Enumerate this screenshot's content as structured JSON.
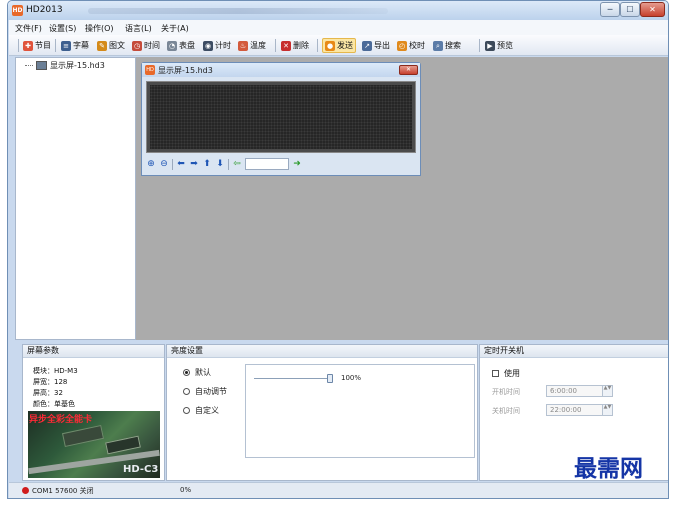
{
  "window": {
    "title": "HD2013",
    "app_icon_label": "HD",
    "minimize_glyph": "─",
    "maximize_glyph": "☐",
    "close_glyph": "✕"
  },
  "menu": [
    {
      "label": "文件(F)"
    },
    {
      "label": "设置(S)"
    },
    {
      "label": "操作(O)"
    },
    {
      "label": "语言(L)"
    },
    {
      "label": "关于(A)"
    }
  ],
  "toolbar": [
    {
      "label": "节目",
      "icon": "program-icon",
      "glyph": "✚",
      "color": "#e0533c"
    },
    {
      "label": "字幕",
      "icon": "subtitle-icon",
      "glyph": "≡",
      "color": "#3d5f8f"
    },
    {
      "label": "图文",
      "icon": "picture-text-icon",
      "glyph": "✎",
      "color": "#d48a1a"
    },
    {
      "label": "时间",
      "icon": "time-icon",
      "glyph": "◷",
      "color": "#c54b3a"
    },
    {
      "label": "表盘",
      "icon": "dial-icon",
      "glyph": "◔",
      "color": "#7a8797"
    },
    {
      "label": "计时",
      "icon": "timer-icon",
      "glyph": "◉",
      "color": "#3c4c63"
    },
    {
      "label": "温度",
      "icon": "temperature-icon",
      "glyph": "♨",
      "color": "#d35a3c"
    },
    {
      "label": "删除",
      "icon": "delete-icon",
      "glyph": "✕",
      "color": "#c72e2e"
    },
    {
      "label": "发送",
      "icon": "send-icon",
      "glyph": "●",
      "color": "#e88a16",
      "active": true
    },
    {
      "label": "导出",
      "icon": "export-icon",
      "glyph": "↗",
      "color": "#4b6a98"
    },
    {
      "label": "校时",
      "icon": "clock-sync-icon",
      "glyph": "◴",
      "color": "#e08a1d"
    },
    {
      "label": "搜索",
      "icon": "search-icon",
      "glyph": "⌕",
      "color": "#5b7ca8"
    },
    {
      "label": "预览",
      "icon": "preview-icon",
      "glyph": "▶",
      "color": "#3d4a5a"
    }
  ],
  "tree": {
    "item_label": "显示屏-15.hd3"
  },
  "child_window": {
    "title": "显示屏-15.hd3",
    "close_glyph": "✕",
    "tools": {
      "zoom_in": "⊕",
      "zoom_out": "⊖",
      "left": "⬅",
      "right": "➡",
      "up": "⬆",
      "down": "⬇",
      "go_back": "⇦",
      "go_forward": "➜",
      "position_value": ""
    }
  },
  "screen_params": {
    "header": "屏幕参数",
    "module": "模块：HD-M3",
    "width": "屏宽：128",
    "height": "屏高：32",
    "color": "颜色：单基色",
    "photo_headline": "异步全彩全能卡",
    "photo_badge": "HD-C3"
  },
  "brightness": {
    "header": "亮度设置",
    "options": [
      {
        "label": "默认",
        "selected": true
      },
      {
        "label": "自动调节",
        "selected": false
      },
      {
        "label": "自定义",
        "selected": false
      }
    ],
    "level_percent": 100,
    "value_text": "100%"
  },
  "timer_power": {
    "header": "定时开关机",
    "use_label": "使用",
    "use_checked": false,
    "on_label": "开机时间",
    "on_value": "6:00:00",
    "off_label": "关机时间",
    "off_value": "22:00:00",
    "spin_glyphs": "▲▼"
  },
  "watermark": "最需网",
  "status": {
    "connection": "COM1 57600 关闭",
    "progress_text": "0%",
    "indicator_color": "#d01c1c"
  }
}
